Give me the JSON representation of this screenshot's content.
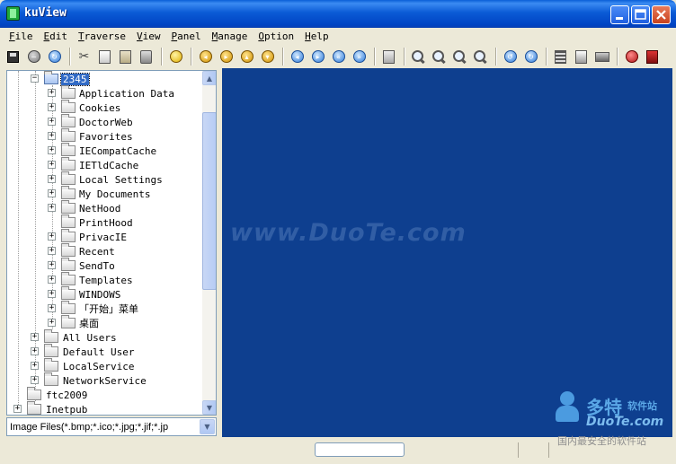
{
  "window": {
    "title": "kuView"
  },
  "menu": [
    "File",
    "Edit",
    "Traverse",
    "View",
    "Panel",
    "Manage",
    "Option",
    "Help"
  ],
  "toolbar": {
    "icons": [
      "save-icon",
      "stop-icon",
      "refresh-icon",
      "cut-icon",
      "copy-icon",
      "paste-icon",
      "delete-icon",
      "circle-icon",
      "previous-icon",
      "next-icon",
      "up-icon",
      "first-icon",
      "back-icon",
      "forward-icon",
      "rewind-icon",
      "fast-forward-icon",
      "fit-icon",
      "zoom-in-icon",
      "zoom-out-icon",
      "zoom-fit-icon",
      "zoom-actual-icon",
      "rotate-left-icon",
      "rotate-right-icon",
      "filmstrip-icon",
      "print-icon",
      "scanner-icon",
      "wallpaper-icon",
      "exit-icon"
    ]
  },
  "tree": {
    "items": [
      {
        "label": "2345",
        "selected": true
      },
      {
        "label": "Application Data"
      },
      {
        "label": "Cookies"
      },
      {
        "label": "DoctorWeb"
      },
      {
        "label": "Favorites"
      },
      {
        "label": "IECompatCache"
      },
      {
        "label": "IETldCache"
      },
      {
        "label": "Local Settings"
      },
      {
        "label": "My Documents"
      },
      {
        "label": "NetHood"
      },
      {
        "label": "PrintHood"
      },
      {
        "label": "PrivacIE"
      },
      {
        "label": "Recent"
      },
      {
        "label": "SendTo"
      },
      {
        "label": "Templates"
      },
      {
        "label": "WINDOWS"
      },
      {
        "label": "「开始」菜单"
      },
      {
        "label": "桌面"
      },
      {
        "label": "All Users"
      },
      {
        "label": "Default User"
      },
      {
        "label": "LocalService"
      },
      {
        "label": "NetworkService"
      },
      {
        "label": "ftc2009"
      },
      {
        "label": "Inetpub"
      }
    ]
  },
  "filter": {
    "value": "Image Files(*.bmp;*.ico;*.jpg;*.jif;*.jp"
  },
  "watermark": {
    "text": "www.DuoTe.com"
  },
  "corner_logo": {
    "name": "多特",
    "suffix": "软件站",
    "domain": "DuoTe.com",
    "slogan": "国内最安全的软件站"
  },
  "colors": {
    "image_view_bg": "#0e3f8f",
    "selection": "#316ac5",
    "titlebar": "#0b5bd6"
  }
}
